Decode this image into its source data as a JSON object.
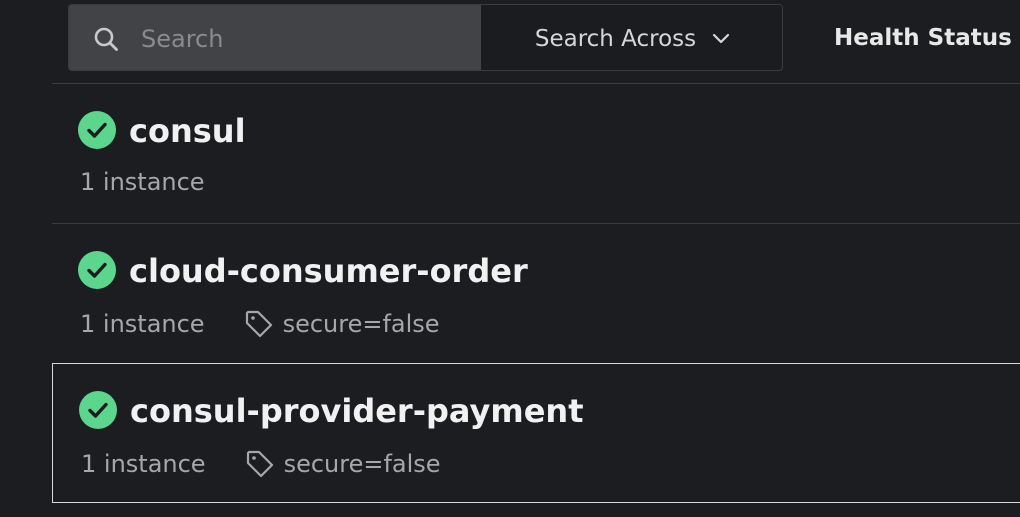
{
  "toolbar": {
    "search": {
      "placeholder": "Search",
      "value": ""
    },
    "search_across_label": "Search Across",
    "health_status_label": "Health Status"
  },
  "services": [
    {
      "name": "consul",
      "instances": "1 instance",
      "tag": "",
      "status": "passing"
    },
    {
      "name": "cloud-consumer-order",
      "instances": "1 instance",
      "tag": "secure=false",
      "status": "passing"
    },
    {
      "name": "consul-provider-payment",
      "instances": "1 instance",
      "tag": "secure=false",
      "status": "passing"
    }
  ],
  "colors": {
    "background": "#1c1d20",
    "status_passing": "#5bd68c",
    "search_field": "#424346"
  },
  "icons": {
    "search": "search-icon",
    "dropdown": "chevron-down-icon",
    "status": "check-circle-icon",
    "tag": "tag-icon"
  }
}
